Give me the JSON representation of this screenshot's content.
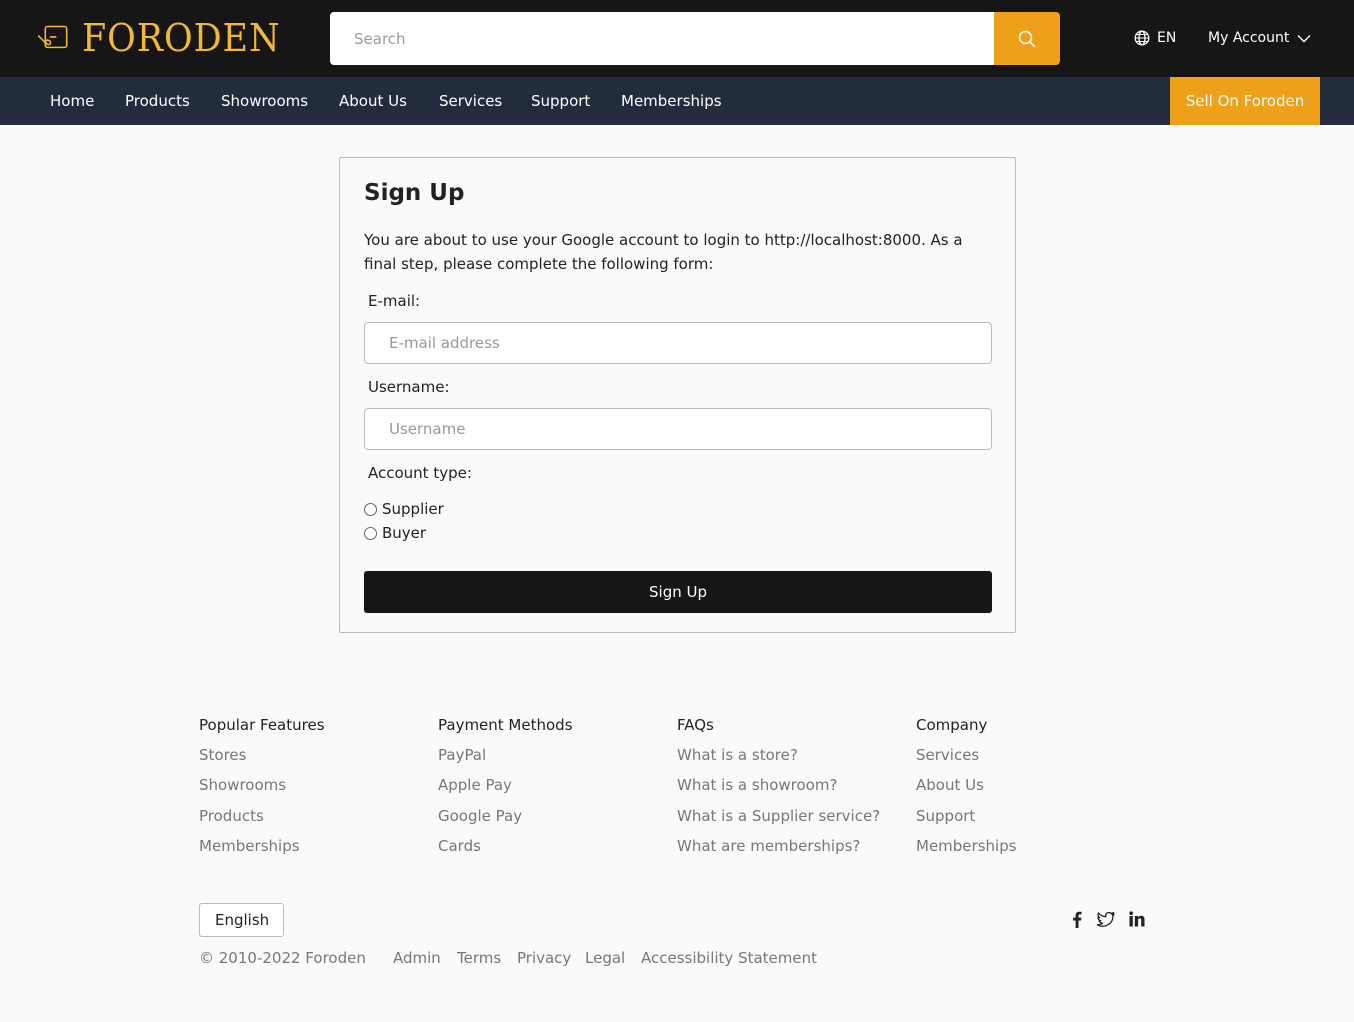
{
  "header": {
    "brand": "FORODEN",
    "search_placeholder": "Search",
    "language": "EN",
    "account_label": "My Account"
  },
  "nav": {
    "items": [
      "Home",
      "Products",
      "Showrooms",
      "About Us",
      "Services",
      "Support",
      "Memberships"
    ],
    "sell_label": "Sell On Foroden"
  },
  "form": {
    "title": "Sign Up",
    "intro": "You are about to use your Google account to login to http://localhost:8000. As a final step, please complete the following form:",
    "email_label": "E-mail:",
    "email_placeholder": "E-mail address",
    "username_label": "Username:",
    "username_placeholder": "Username",
    "account_type_label": "Account type:",
    "account_types": [
      "Supplier",
      "Buyer"
    ],
    "submit_label": "Sign Up"
  },
  "footer": {
    "columns": [
      {
        "heading": "Popular Features",
        "links": [
          "Stores",
          "Showrooms",
          "Products",
          "Memberships"
        ]
      },
      {
        "heading": "Payment Methods",
        "links": [
          "PayPal",
          "Apple Pay",
          "Google Pay",
          "Cards"
        ]
      },
      {
        "heading": "FAQs",
        "links": [
          "What is a store?",
          "What is a showroom?",
          "What is a Supplier service?",
          "What are memberships?"
        ]
      },
      {
        "heading": "Company",
        "links": [
          "Services",
          "About Us",
          "Support",
          "Memberships"
        ]
      }
    ],
    "language_select": "English",
    "copyright": "© 2010-2022 Foroden",
    "bottom_links": [
      "Admin",
      "Terms",
      "Privacy",
      "Legal",
      "Accessibility Statement"
    ],
    "social_icons": [
      "facebook-icon",
      "twitter-icon",
      "linkedin-icon"
    ]
  },
  "colors": {
    "brand": "#f5b82e",
    "accent": "#eea01a",
    "topbar": "#161616",
    "navbar": "#222c3d"
  }
}
